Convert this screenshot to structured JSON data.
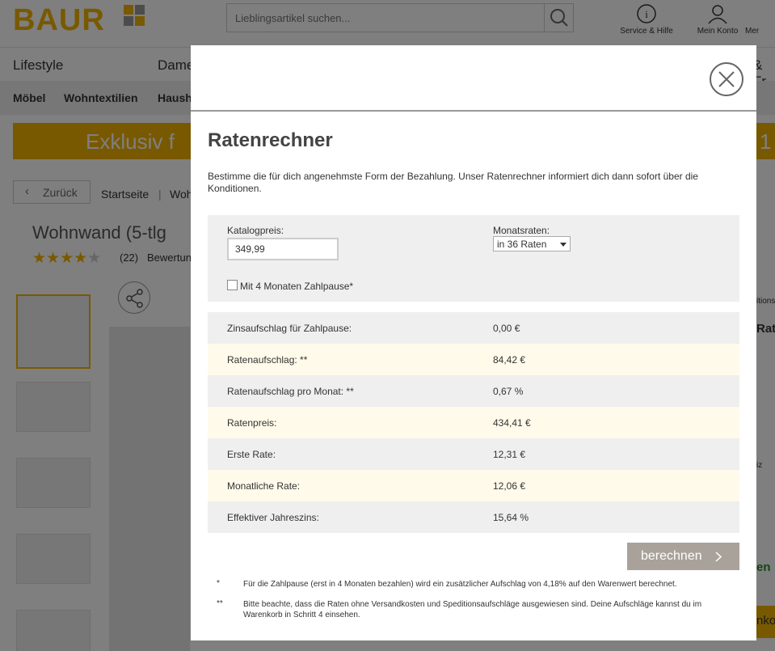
{
  "page": {
    "logo": "BAUR",
    "search_placeholder": "Lieblingsartikel suchen...",
    "header_service": "Service & Hilfe",
    "header_account": "Mein Konto",
    "header_more": "Mer",
    "nav1": [
      "Lifestyle",
      "Dame",
      "& Fr"
    ],
    "nav2": [
      "Möbel",
      "Wohntextilien",
      "Haush"
    ],
    "promo": "Exklusiv f",
    "promo_right": "1",
    "back": "Zurück",
    "crumbs": [
      "Startseite",
      "Woh"
    ],
    "product_title": "Wohnwand (5-tlg",
    "rating_stars": 4,
    "rating_count": "(22)",
    "rating_text": "Bewertun",
    "right_texts": [
      "itions",
      "Rate",
      "iz",
      "en",
      "nko"
    ]
  },
  "modal": {
    "title": "Ratenrechner",
    "intro": "Bestimme die für dich angenehmste Form der Bezahlung. Unser Ratenrechner informiert dich dann sofort über die Konditionen.",
    "price_label": "Katalogpreis:",
    "price_value": "349,99",
    "installments_label": "Monatsraten:",
    "installments_selected": "in 36 Raten",
    "pause_label": "Mit 4 Monaten Zahlpause*",
    "rows": [
      {
        "label": "Zinsaufschlag für Zahlpause:",
        "value": "0,00 €"
      },
      {
        "label": "Ratenaufschlag: **",
        "value": "84,42 €"
      },
      {
        "label": "Ratenaufschlag pro Monat: **",
        "value": "0,67 %"
      },
      {
        "label": "Ratenpreis:",
        "value": "434,41 €"
      },
      {
        "label": "Erste Rate:",
        "value": "12,31 €"
      },
      {
        "label": "Monatliche Rate:",
        "value": "12,06 €"
      },
      {
        "label": "Effektiver Jahreszins:",
        "value": "15,64 %"
      }
    ],
    "calc_button": "berechnen",
    "note1_mark": "*",
    "note1": "Für die Zahlpause (erst in 4 Monaten bezahlen) wird ein zusätzlicher Aufschlag von 4,18% auf den Warenwert berechnet.",
    "note2_mark": "**",
    "note2": "Bitte beachte, dass die Raten ohne Versandkosten und Speditionsaufschläge ausgewiesen sind. Deine Aufschläge kannst du im Warenkorb in Schritt 4 einsehen."
  },
  "colors": {
    "brand": "#f2b200",
    "button": "#a9a29a",
    "row_alt": "#fffaea",
    "row": "#efefef"
  }
}
